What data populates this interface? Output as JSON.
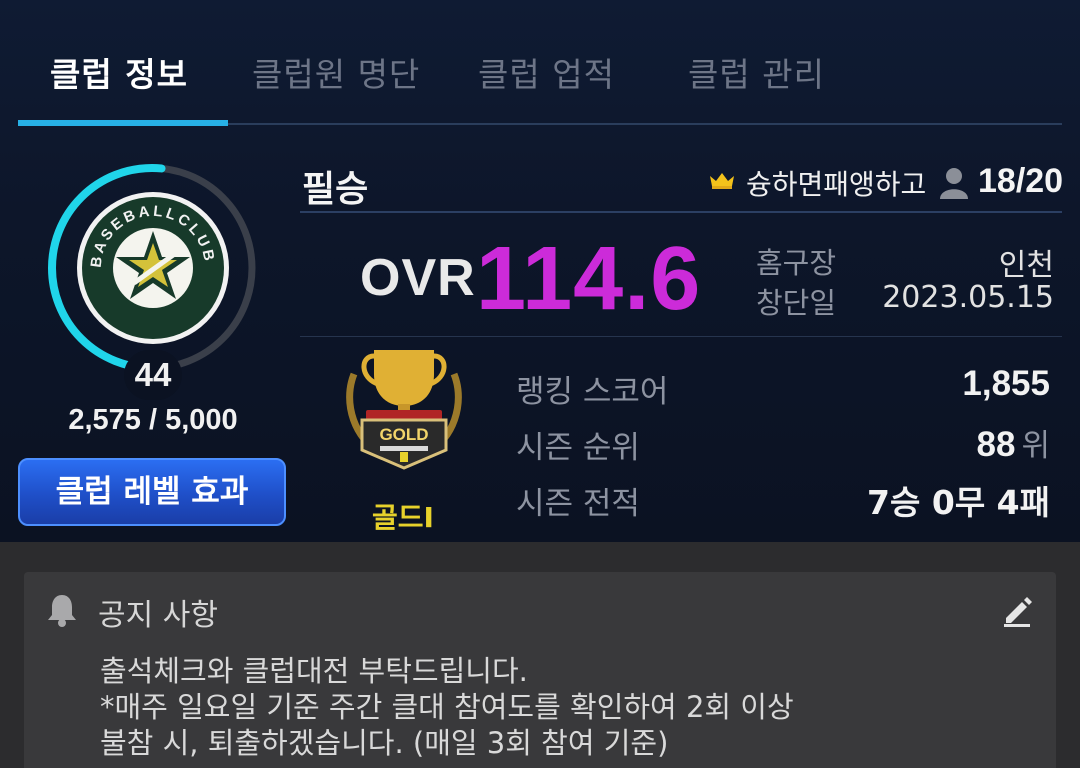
{
  "tabs": [
    {
      "label": "클럽 정보",
      "active": true
    },
    {
      "label": "클럽원 명단",
      "active": false
    },
    {
      "label": "클럽 업적",
      "active": false
    },
    {
      "label": "클럽 관리",
      "active": false
    }
  ],
  "club": {
    "name": "필승",
    "leader": "슝하면패앵하고",
    "members": "18/20",
    "emblem_text": "BASEBALLCLUB",
    "level": "44",
    "exp": "2,575 / 5,000",
    "exp_fraction": 0.515,
    "level_effect_button": "클럽 레벨 효과"
  },
  "ovr": {
    "label": "OVR",
    "value": "114.6"
  },
  "details": {
    "home_label": "홈구장",
    "home_value": "인천",
    "founded_label": "창단일",
    "founded_value": "2023.05.15"
  },
  "tier": {
    "badge_text": "GOLD",
    "label": "골드I"
  },
  "stats": {
    "ranking_label": "랭킹 스코어",
    "ranking_value": "1,855",
    "season_rank_label": "시즌 순위",
    "season_rank_value": "88",
    "season_rank_unit": "위",
    "season_record_label": "시즌 전적",
    "season_record_value": "7승 0무 4패"
  },
  "notice": {
    "title": "공지 사항",
    "lines": [
      "출석체크와 클럽대전 부탁드립니다.",
      "*매주 일요일 기준 주간 클대 참여도를 확인하여 2회 이상",
      "불참 시, 퇴출하겠습니다. (매일 3회 참여 기준)"
    ]
  },
  "colors": {
    "accent_tab": "#27b0e6",
    "ovr": "#cc2bd9",
    "tier": "#e7d12b",
    "ring": "#20d5ea",
    "button": "#2b6ef2"
  }
}
